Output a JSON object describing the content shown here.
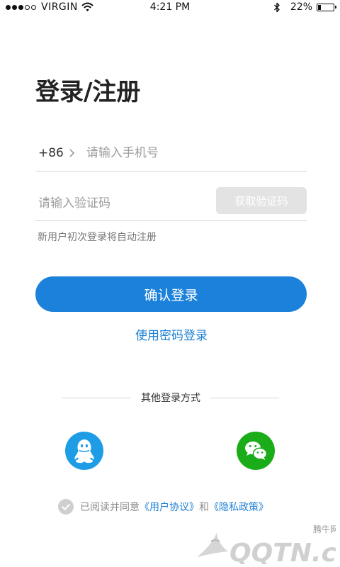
{
  "status_bar": {
    "signal_filled": 3,
    "signal_total": 5,
    "carrier": "VIRGIN",
    "time": "4:21  PM",
    "battery_percent_text": "22%",
    "battery_level": 0.22
  },
  "page_title": "登录/注册",
  "phone": {
    "country_code": "+86",
    "placeholder": "请输入手机号",
    "value": ""
  },
  "verification": {
    "placeholder": "请输入验证码",
    "value": "",
    "get_code_label": "获取验证码"
  },
  "hint": "新用户初次登录将自动注册",
  "confirm_label": "确认登录",
  "password_login_label": "使用密码登录",
  "other_login": {
    "label": "其他登录方式",
    "options": [
      {
        "icon": "qq-icon",
        "color": "#1e9de6"
      },
      {
        "icon": "wechat-icon",
        "color": "#1aad19"
      }
    ]
  },
  "agreement": {
    "checked": true,
    "prefix": "已阅读并同意",
    "user_agreement": "《用户协议》",
    "and": "和",
    "privacy_policy": "《隐私政策》"
  },
  "watermark": {
    "brand_cn": "腾牛网",
    "brand_en": "QQTN.com"
  },
  "colors": {
    "accent": "#1b81db",
    "link": "#1b7fd4",
    "disabled_button": "#e3e3e3",
    "qq": "#1e9de6",
    "wechat": "#1aad19"
  }
}
